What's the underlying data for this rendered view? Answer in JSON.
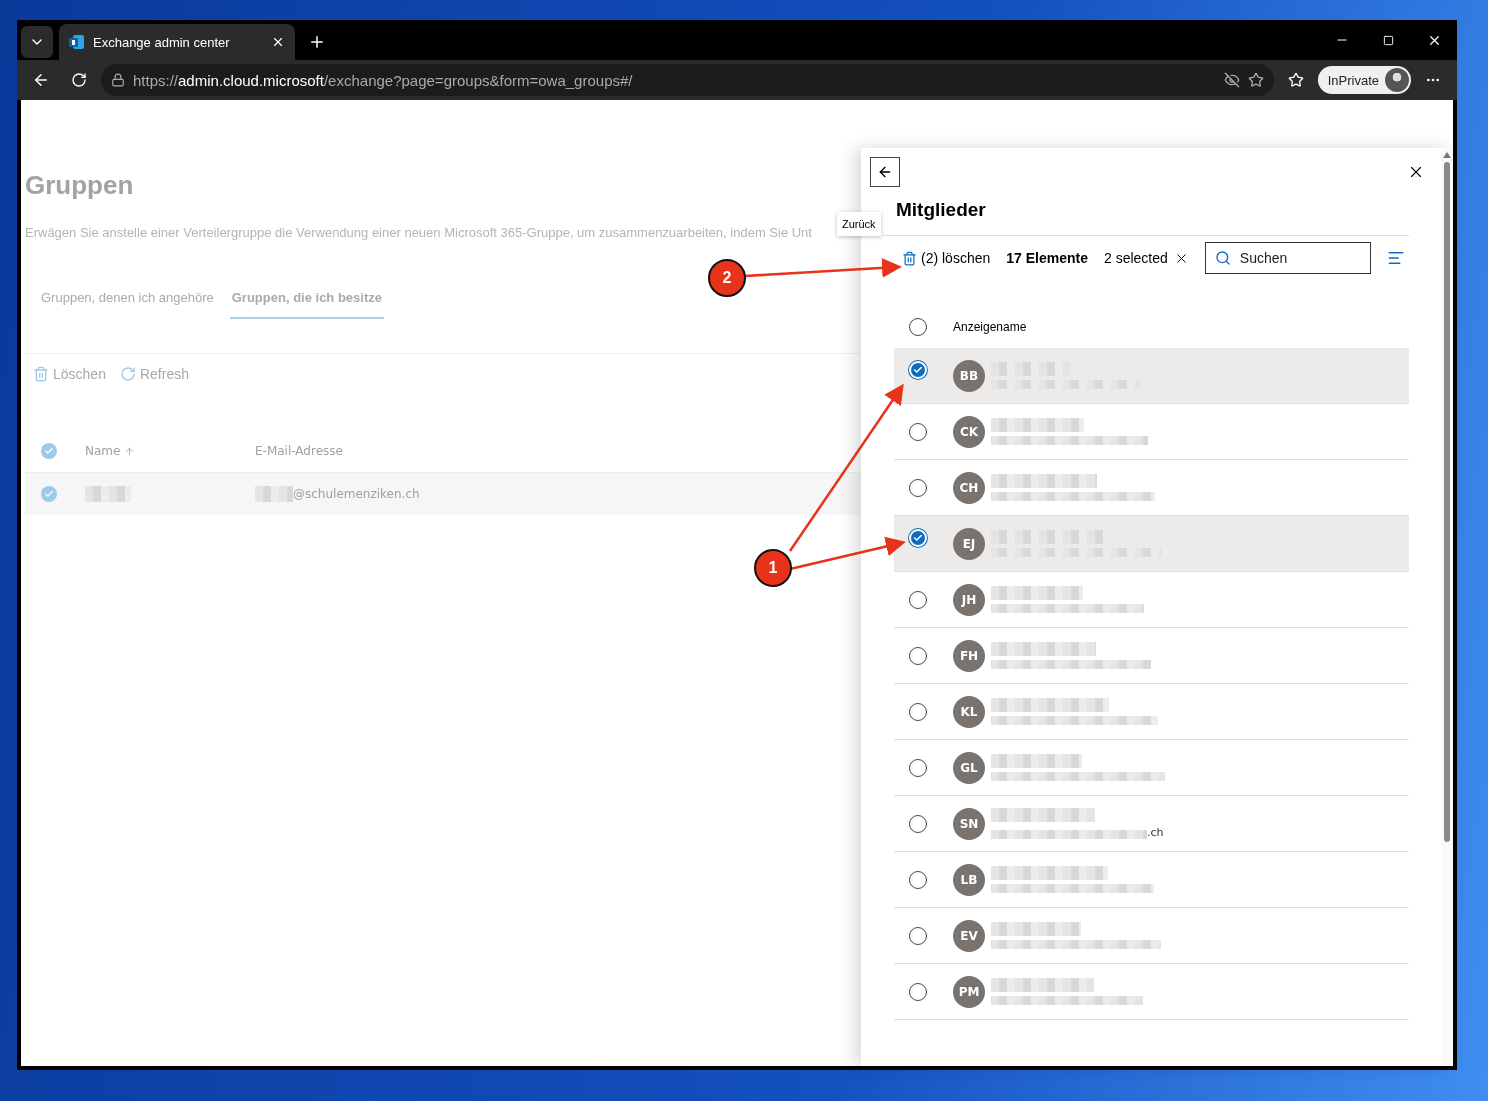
{
  "browser": {
    "tab_title": "Exchange admin center",
    "url_scheme": "https://",
    "url_host": "admin.cloud.microsoft",
    "url_path": "/exchange?page=groups&form=owa_groups#/",
    "profile_label": "InPrivate"
  },
  "page": {
    "title": "Gruppen",
    "description": "Erwägen Sie anstelle einer Verteilergruppe die Verwendung einer neuen Microsoft 365-Gruppe, um zusammenzuarbeiten, indem Sie Unt",
    "tabs": [
      {
        "label": "Gruppen, denen ich angehöre",
        "selected": false
      },
      {
        "label": "Gruppen, die ich besitze",
        "selected": true
      }
    ],
    "toolbar": [
      {
        "kind": "delete",
        "label": "Löschen"
      },
      {
        "kind": "refresh",
        "label": "Refresh"
      }
    ],
    "table": {
      "all_checked": true,
      "columns": [
        "Name",
        "E-Mail-Adresse"
      ],
      "rows": [
        {
          "selected": true,
          "email_suffix": "@schulemenziken.ch"
        }
      ]
    }
  },
  "panel": {
    "tooltip": "Zurück",
    "title": "Mitglieder",
    "delete_label": "(2) löschen",
    "count": "17 Elemente",
    "selection": "2 selected",
    "search": {
      "placeholder": "Suchen"
    },
    "column": "Anzeigename",
    "all_checked": false,
    "members": [
      {
        "initials": "BB",
        "selected": true
      },
      {
        "initials": "CK",
        "selected": false
      },
      {
        "initials": "CH",
        "selected": false
      },
      {
        "initials": "EJ",
        "selected": true
      },
      {
        "initials": "JH",
        "selected": false
      },
      {
        "initials": "FH",
        "selected": false
      },
      {
        "initials": "KL",
        "selected": false
      },
      {
        "initials": "GL",
        "selected": false
      },
      {
        "initials": "SN",
        "selected": false,
        "email_tail": ".ch"
      },
      {
        "initials": "LB",
        "selected": false
      },
      {
        "initials": "EV",
        "selected": false
      },
      {
        "initials": "PM",
        "selected": false
      }
    ]
  },
  "annotations": [
    {
      "number": "1"
    },
    {
      "number": "2"
    }
  ]
}
